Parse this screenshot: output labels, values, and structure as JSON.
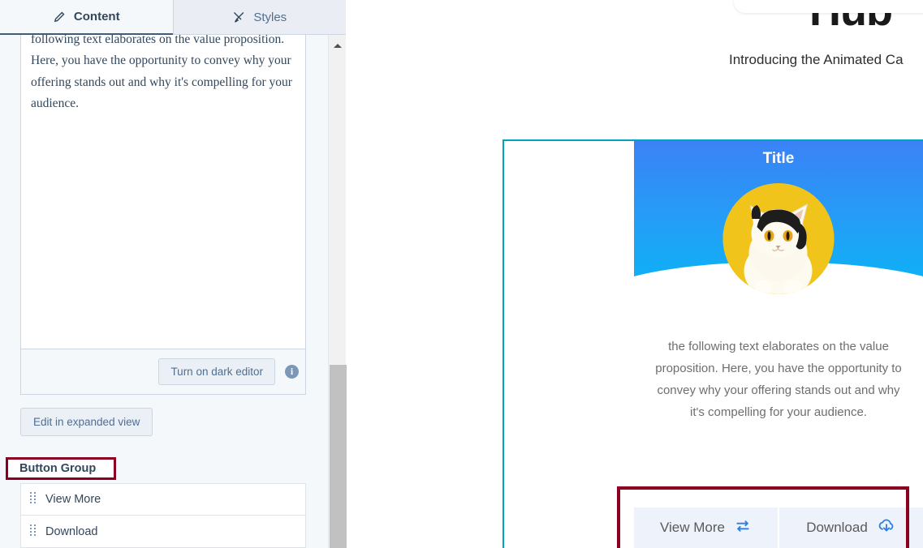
{
  "left_panel": {
    "tabs": [
      {
        "label": "Content",
        "icon": "pencil-icon",
        "active": true
      },
      {
        "label": "Styles",
        "icon": "brush-icon",
        "active": false
      }
    ],
    "editor": {
      "body_text": "Introduce the essence of your message, while the following text elaborates on the value proposition. Here, you have the opportunity to convey why your offering stands out and why it's compelling for your audience.",
      "dark_editor_button": "Turn on dark editor",
      "info_icon_glyph": "i"
    },
    "expanded_view_button": "Edit in expanded view",
    "button_group": {
      "section_label": "Button Group",
      "highlight_color": "#8b0020",
      "items": [
        {
          "label": "View More",
          "handle": "drag-handle-icon"
        },
        {
          "label": "Download",
          "handle": "drag-handle-icon"
        }
      ]
    },
    "scrollbar": {
      "arrow": "scroll-up-arrow"
    }
  },
  "preview": {
    "hero_heading": "Hub",
    "hero_subtitle": "Introducing the Animated Ca",
    "selection_border_color": "#00a4bd",
    "card": {
      "title": "Title",
      "header_gradient_from": "#3b82f6",
      "header_gradient_to": "#06b6f4",
      "avatar": {
        "alt": "cat-photo",
        "background": "#f0c41b"
      },
      "body_text": "Introduce the essence of your message, while the following text elaborates on the value proposition. Here, you have the opportunity to convey why your offering stands out and why it's compelling for your audience.",
      "actions": [
        {
          "label": "View More",
          "icon": "exchange-arrows-icon",
          "icon_color": "#2a7fe0"
        },
        {
          "label": "Download",
          "icon": "cloud-download-icon",
          "icon_color": "#2a7fe0"
        }
      ],
      "actions_highlight_color": "#8b0020"
    }
  }
}
